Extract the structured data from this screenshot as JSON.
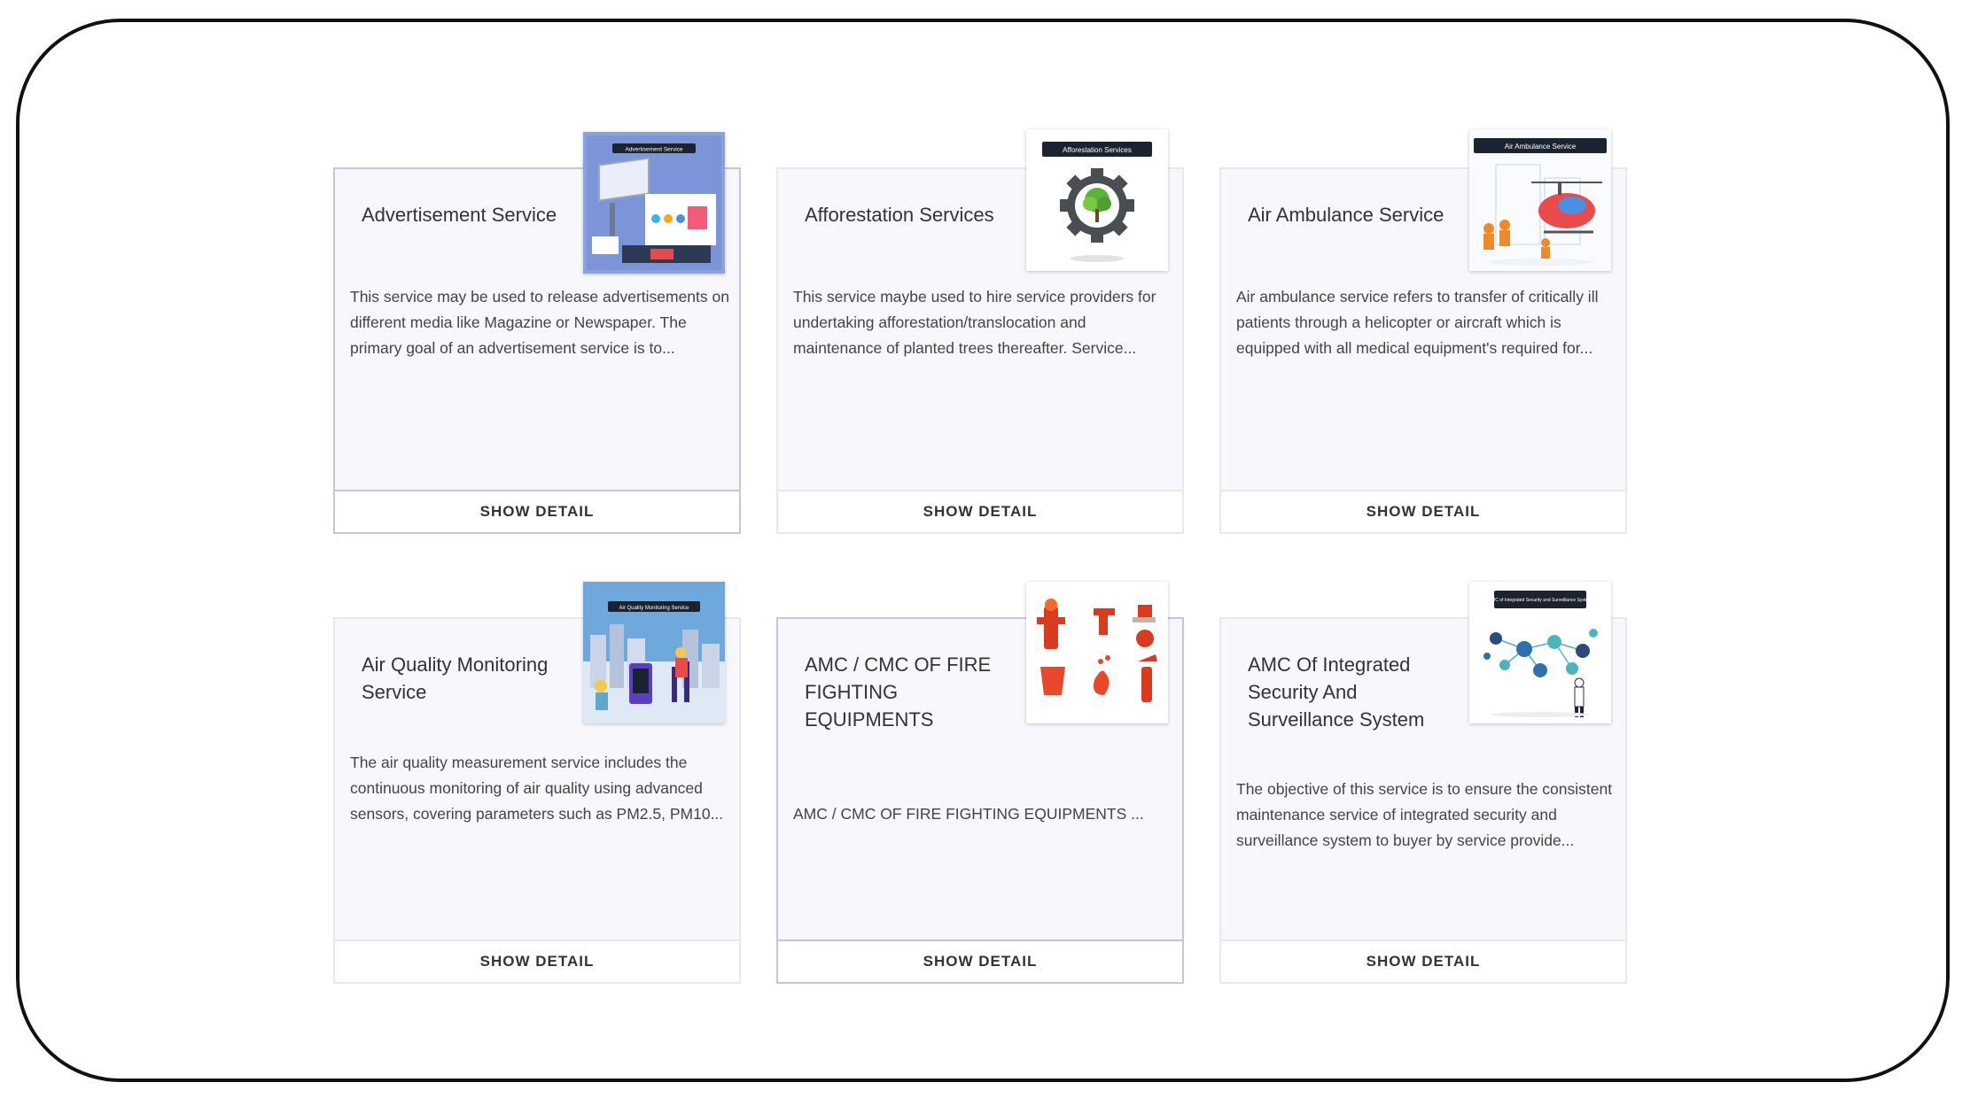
{
  "services": [
    {
      "title": "Advertisement Service",
      "description": "This service may be used to release advertisements on different media like Magazine or Newspaper. The primary goal of an advertisement service is to...",
      "button": "SHOW DETAIL",
      "image_banner": "Advertisement Service",
      "image_icon": "billboard-advertisement-icon"
    },
    {
      "title": "Afforestation Services",
      "description": "This service maybe used to hire service providers for undertaking afforestation/translocation and maintenance of planted trees thereafter. Service...",
      "button": "SHOW DETAIL",
      "image_banner": "Afforestation Services",
      "image_icon": "tree-gear-icon"
    },
    {
      "title": "Air Ambulance Service",
      "description": "Air ambulance service refers to transfer of critically ill patients through a helicopter or aircraft which is equipped with all medical equipment's required for...",
      "button": "SHOW DETAIL",
      "image_banner": "Air Ambulance Service",
      "image_icon": "helicopter-icon"
    },
    {
      "title": "Air Quality Monitoring Service",
      "description": "The air quality measurement service includes the continuous monitoring of air quality using advanced sensors, covering parameters such as PM2.5, PM10...",
      "button": "SHOW DETAIL",
      "image_banner": "Air Quality Monitoring Service",
      "image_icon": "city-air-monitor-icon"
    },
    {
      "title": "AMC / CMC OF FIRE FIGHTING EQUIPMENTS",
      "description": "AMC / CMC OF FIRE FIGHTING EQUIPMENTS ...",
      "button": "SHOW DETAIL",
      "image_banner": "",
      "image_icon": "fire-equipment-icon"
    },
    {
      "title": "AMC Of Integrated Security And Surveillance System",
      "description": "The objective of this service is to ensure the consistent maintenance service of integrated security and surveillance system to buyer by service provide...",
      "button": "SHOW DETAIL",
      "image_banner": "AMC of Integrated Security and Surveillance System",
      "image_icon": "security-network-icon"
    }
  ],
  "colors": {
    "card_bg": "#f8f8fc",
    "card_border": "#e8e8f0",
    "card_border_highlight": "#c6c3e3",
    "banner_bg": "#1b2331",
    "title_text": "#333333"
  }
}
